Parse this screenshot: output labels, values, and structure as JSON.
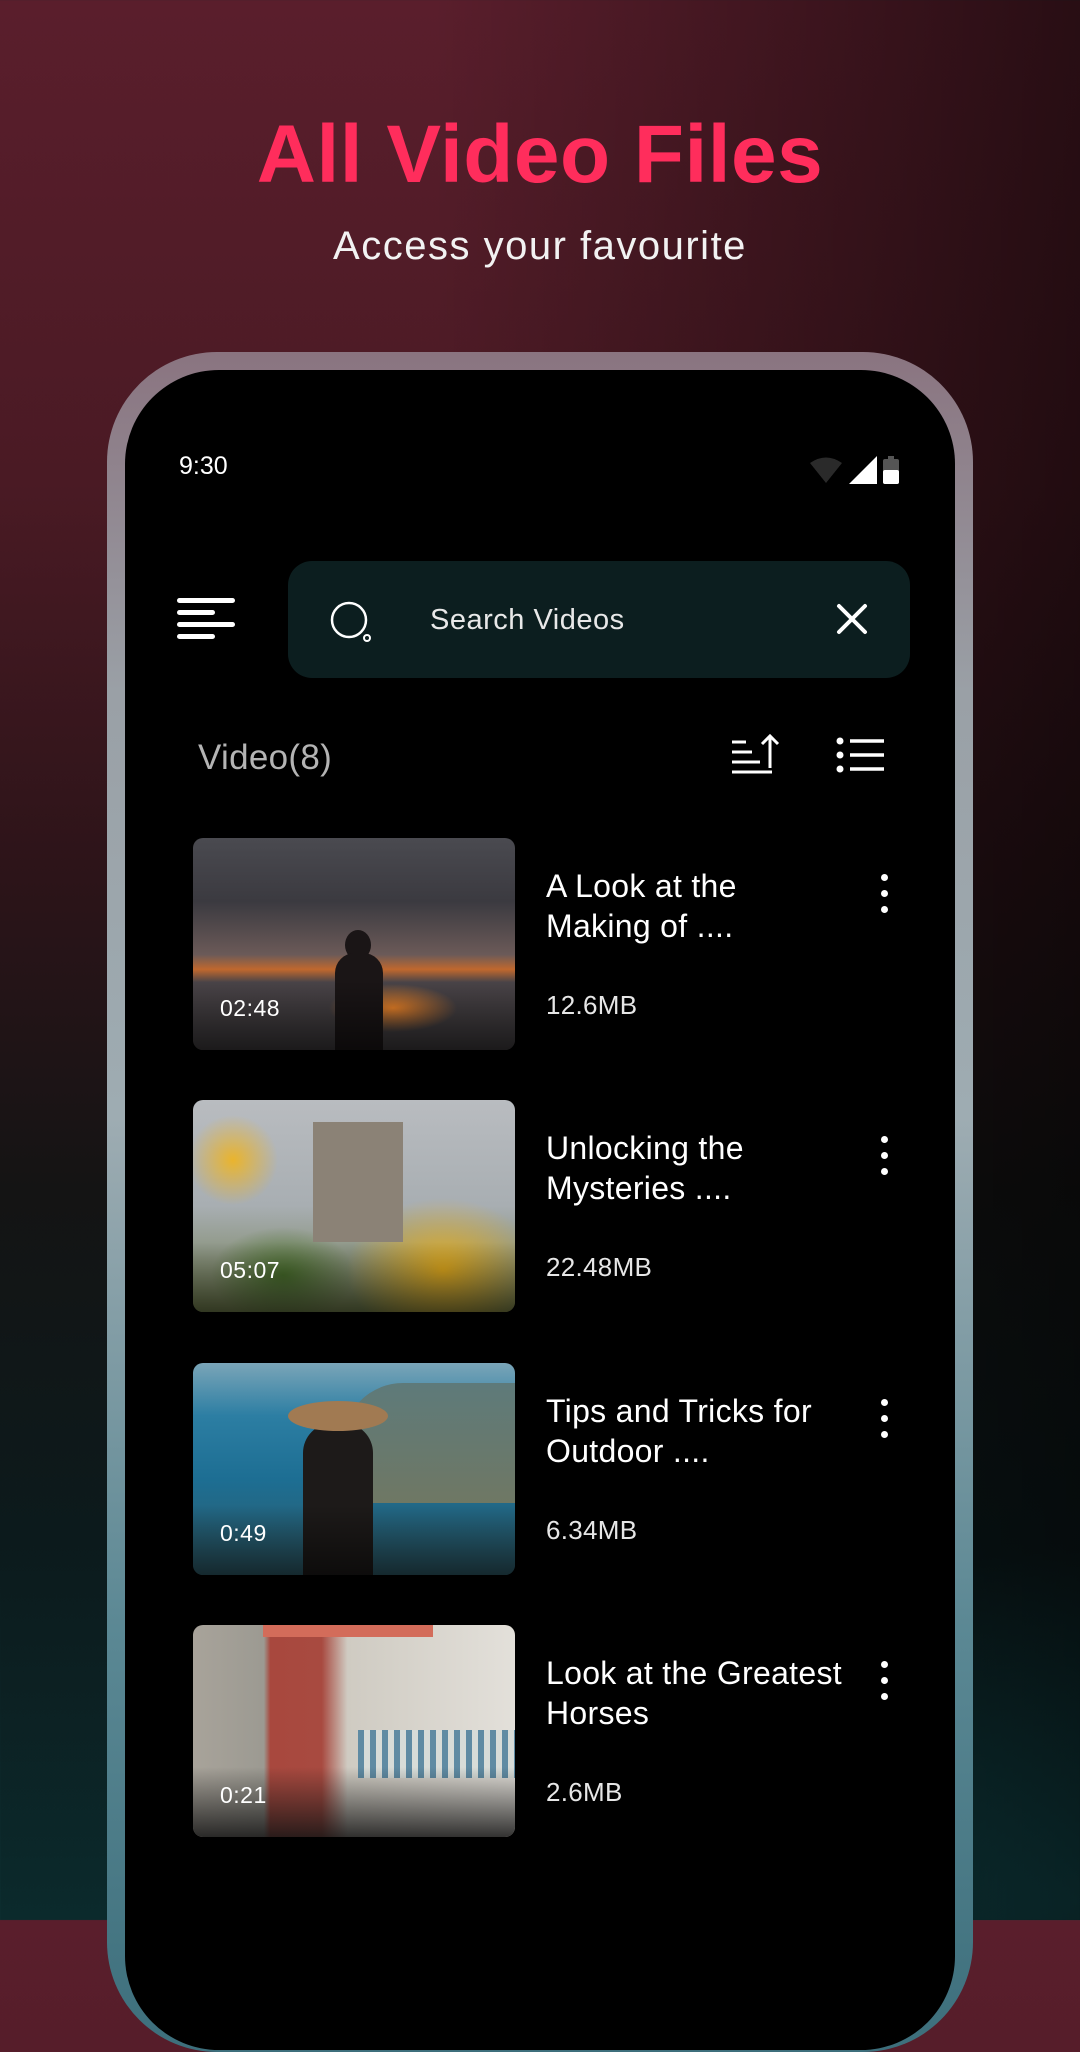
{
  "promo": {
    "headline": "All Video Files",
    "subheadline": "Access your favourite"
  },
  "colors": {
    "accent": "#ff2d5c",
    "search_bar_bg": "#0c1e1f",
    "screen_bg": "#000000"
  },
  "status_bar": {
    "time": "9:30",
    "icons": [
      "wifi-icon",
      "cellular-signal-icon",
      "battery-icon"
    ]
  },
  "toolbar": {
    "menu_icon": "menu-icon",
    "search": {
      "placeholder": "Search Videos",
      "value": "",
      "search_icon": "search-icon",
      "clear_icon": "close-icon"
    }
  },
  "list_header": {
    "count_label": "Video(8)",
    "sort_icon": "sort-ascending-icon",
    "view_icon": "list-view-icon"
  },
  "videos": [
    {
      "title": "A Look at the Making of ....",
      "size": "12.6MB",
      "duration": "02:48"
    },
    {
      "title": "Unlocking the Mysteries ....",
      "size": "22.48MB",
      "duration": "05:07"
    },
    {
      "title": "Tips and Tricks for Outdoor ....",
      "size": "6.34MB",
      "duration": "0:49"
    },
    {
      "title": "Look at the Greatest Horses",
      "size": "2.6MB",
      "duration": "0:21"
    }
  ]
}
